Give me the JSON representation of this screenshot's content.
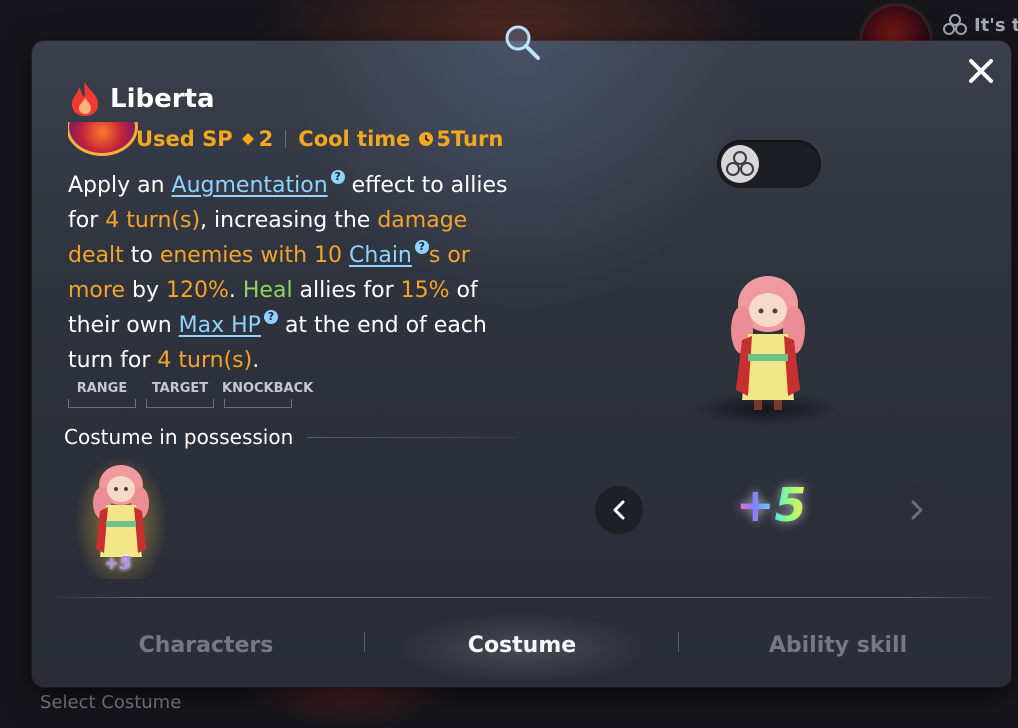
{
  "background": {
    "top_right_text": "It's th",
    "bottom_left_text": "Select Costume"
  },
  "skill": {
    "name": "Liberta",
    "sp_label": "Used SP",
    "sp_value": "2",
    "cool_label": "Cool time",
    "cool_value": "5Turn",
    "desc": {
      "p1": "Apply an ",
      "augmentation": "Augmentation",
      "p2": " effect to allies for ",
      "turns1": "4 turn(s)",
      "p3": ", increasing the ",
      "damage_dealt": "damage dealt",
      "p4": " to ",
      "enemies_with": "enemies with 10",
      "chain": "Chain",
      "s_or_more": "s or more",
      "p5": " by ",
      "pct120": "120%",
      "p6": ". ",
      "heal": "Heal",
      "p7": " allies for ",
      "pct15": "15%",
      "p8": " of their own ",
      "maxhp": "Max HP",
      "p9": " at the end of each turn for ",
      "turns2": "4 turn(s)",
      "p10": "."
    },
    "tags": [
      "RANGE",
      "TARGET",
      "KNOCKBACK"
    ]
  },
  "costume": {
    "possession_title": "Costume in possession",
    "thumb_level": "+5",
    "big_level": "+5"
  },
  "tabs": [
    {
      "label": "Characters",
      "active": false
    },
    {
      "label": "Costume",
      "active": true
    },
    {
      "label": "Ability skill",
      "active": false
    }
  ],
  "colors": {
    "accent_orange": "#f3a42a",
    "link_blue": "#8fd4ff",
    "heal_green": "#8fd664"
  },
  "icons": [
    "flame-icon",
    "search-icon",
    "close-icon",
    "sp-diamond-icon",
    "clock-icon",
    "question-icon",
    "chain-circles-icon",
    "chevron-left-icon",
    "chevron-right-icon"
  ]
}
